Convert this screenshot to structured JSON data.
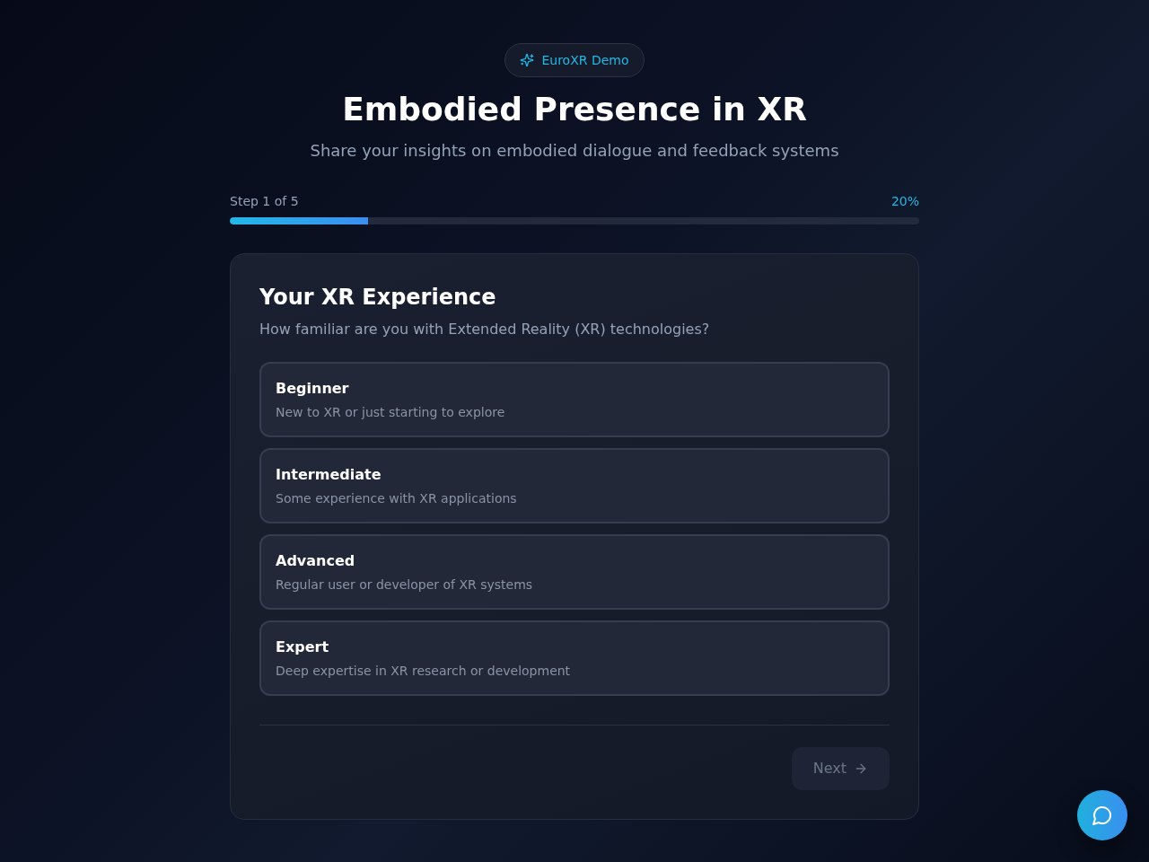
{
  "badge": {
    "label": "EuroXR Demo"
  },
  "title": "Embodied Presence in XR",
  "subtitle": "Share your insights on embodied dialogue and feedback systems",
  "progress": {
    "step_label": "Step 1 of 5",
    "percent": "20%",
    "level": 0.2
  },
  "question": {
    "title": "Your XR Experience",
    "prompt": "How familiar are you with Extended Reality (XR) technologies?",
    "options": [
      {
        "label": "Beginner",
        "description": "New to XR or just starting to explore",
        "selected": false
      },
      {
        "label": "Intermediate",
        "description": "Some experience with XR applications",
        "selected": false
      },
      {
        "label": "Advanced",
        "description": "Regular user or developer of XR systems",
        "selected": false
      },
      {
        "label": "Expert",
        "description": "Deep expertise in XR research or development",
        "selected": false
      }
    ]
  },
  "next_button": {
    "label": "Next",
    "disabled": true
  }
}
